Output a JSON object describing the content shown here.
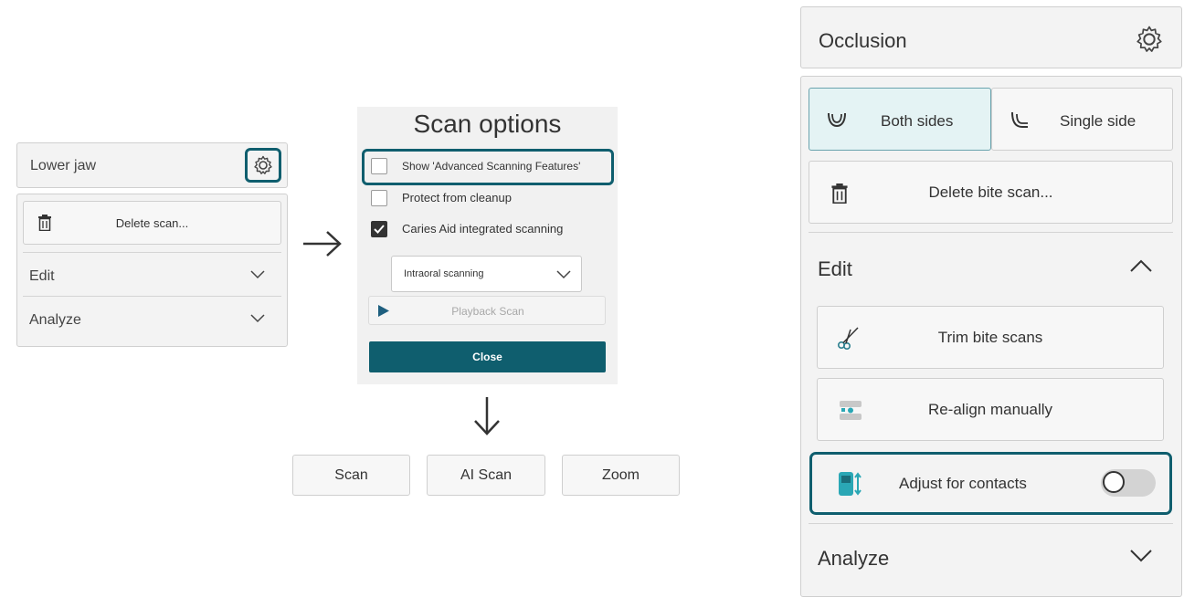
{
  "left_panel": {
    "title": "Lower jaw",
    "delete_label": "Delete scan...",
    "edit_label": "Edit",
    "analyze_label": "Analyze"
  },
  "scan_options": {
    "title": "Scan options",
    "options": [
      {
        "label": "Show 'Advanced Scanning Features'",
        "checked": false
      },
      {
        "label": "Protect from cleanup",
        "checked": false
      },
      {
        "label": "Caries Aid integrated scanning",
        "checked": true
      }
    ],
    "mode_selected": "Intraoral scanning",
    "playback_label": "Playback Scan",
    "close_label": "Close"
  },
  "bottom_buttons": [
    "Scan",
    "AI Scan",
    "Zoom"
  ],
  "right_panel": {
    "title": "Occlusion",
    "both_sides_label": "Both sides",
    "single_side_label": "Single side",
    "delete_bite_label": "Delete bite scan...",
    "edit_label": "Edit",
    "trim_label": "Trim bite scans",
    "realign_label": "Re-align manually",
    "adjust_label": "Adjust for contacts",
    "adjust_enabled": false,
    "analyze_label": "Analyze"
  },
  "colors": {
    "accent": "#0f5e6e",
    "selected_bg": "#e4f3f4"
  }
}
